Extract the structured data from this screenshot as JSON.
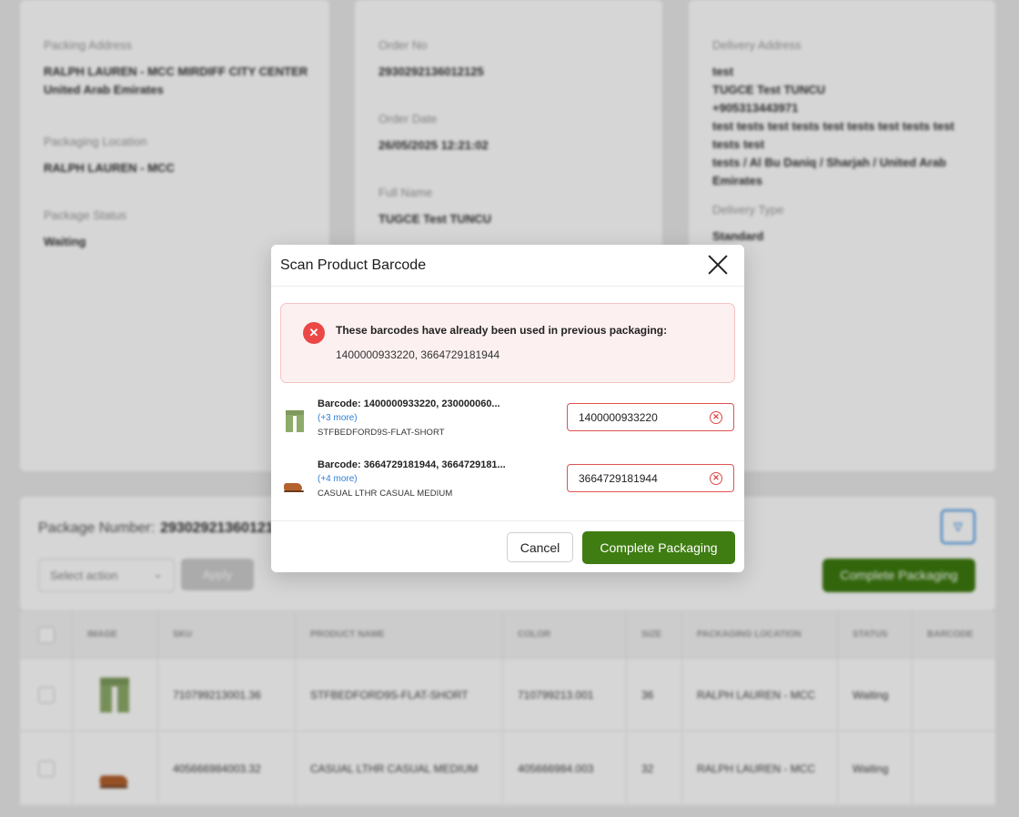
{
  "background": {
    "packing": {
      "address_label": "Packing Address",
      "address_line1": "RALPH LAUREN - MCC MIRDIFF CITY CENTER",
      "address_line2": "United Arab Emirates",
      "location_label": "Packaging Location",
      "location_value": "RALPH LAUREN - MCC",
      "status_label": "Package Status",
      "status_value": "Waiting"
    },
    "order": {
      "no_label": "Order No",
      "no_value": "2930292136012125",
      "date_label": "Order Date",
      "date_value": "26/05/2025 12:21:02",
      "name_label": "Full Name",
      "name_value": "TUGCE Test TUNCU"
    },
    "delivery": {
      "address_label": "Delivery Address",
      "address_line1": "test",
      "address_line2": "TUGCE Test TUNCU",
      "address_line3": "+905313443971",
      "address_line4": "test tests test tests test tests test tests test tests test",
      "address_line5": "tests / Al Bu Daniq / Sharjah / United Arab",
      "address_line6": "Emirates",
      "type_label": "Delivery Type",
      "type_value": "Standard"
    },
    "package": {
      "number_label": "Package Number:",
      "number_value": "29302921360121",
      "select_placeholder": "Select action",
      "apply_label": "Apply",
      "complete_label": "Complete Packaging"
    },
    "table": {
      "headers": [
        "IMAGE",
        "SKU",
        "PRODUCT NAME",
        "COLOR",
        "SIZE",
        "PACKAGING LOCATION",
        "STATUS",
        "BARCODE"
      ],
      "rows": [
        {
          "sku": "710799213001.36",
          "name": "STFBEDFORD9S-FLAT-SHORT",
          "color": "710799213.001",
          "size": "36",
          "location": "RALPH LAUREN - MCC",
          "status": "Waiting"
        },
        {
          "sku": "405666984003.32",
          "name": "CASUAL LTHR CASUAL MEDIUM",
          "color": "405666984.003",
          "size": "32",
          "location": "RALPH LAUREN - MCC",
          "status": "Waiting"
        }
      ]
    }
  },
  "modal": {
    "title": "Scan Product Barcode",
    "alert": {
      "message": "These barcodes have already been used in previous packaging:",
      "codes": "1400000933220, 3664729181944"
    },
    "items": [
      {
        "barcode": "Barcode: 1400000933220, 230000060...",
        "more": "(+3 more)",
        "name": "STFBEDFORD9S-FLAT-SHORT",
        "input_value": "1400000933220"
      },
      {
        "barcode": "Barcode: 3664729181944, 3664729181...",
        "more": "(+4 more)",
        "name": "CASUAL LTHR CASUAL MEDIUM",
        "input_value": "3664729181944"
      }
    ],
    "cancel_label": "Cancel",
    "complete_label": "Complete Packaging"
  },
  "colors": {
    "accent_green": "#3f7d12",
    "error_red": "#ec4747",
    "link_blue": "#2f7fd6"
  },
  "icons": [
    "close-icon",
    "error-icon",
    "clear-icon",
    "filter-icon",
    "chevron-down-icon"
  ]
}
